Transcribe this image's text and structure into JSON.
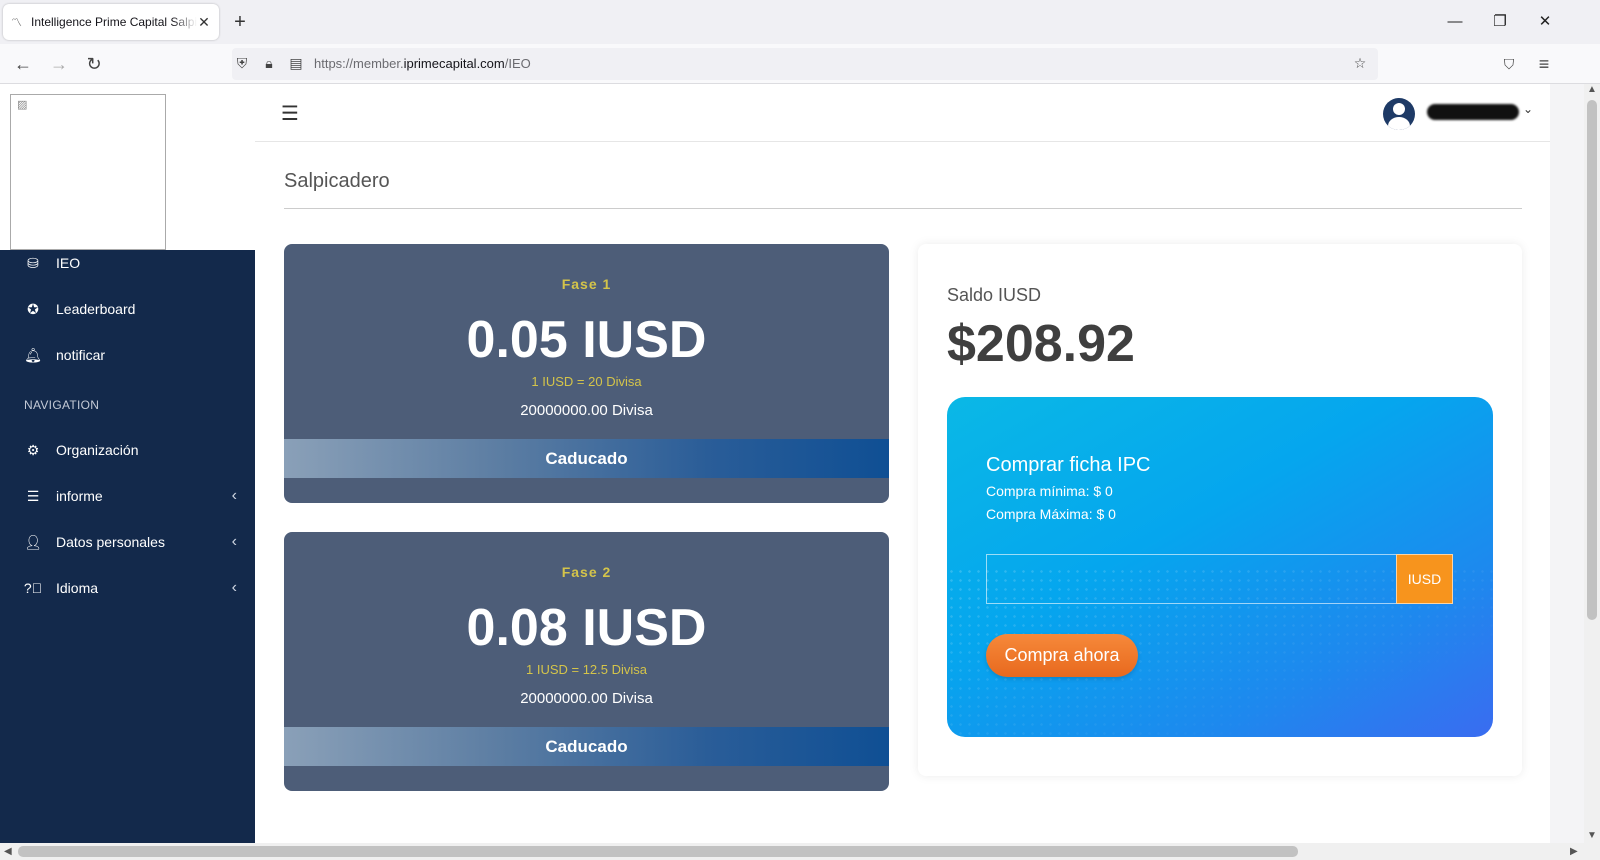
{
  "browser": {
    "tab_title": "Intelligence Prime Capital Salpicadero",
    "tab_close": "✕",
    "new_tab": "+",
    "url_prefix": "https://member.",
    "url_domain": "iprimecapital.com",
    "url_path": "/IEO",
    "icons": {
      "back": "←",
      "forward": "→",
      "reload": "↻",
      "star": "☆",
      "pocket": "⛉",
      "menu": "≡",
      "minimize": "—",
      "restore": "❐",
      "close": "✕"
    }
  },
  "sidebar": {
    "items_top": [
      {
        "label": "IEO",
        "icon": "coins-icon"
      },
      {
        "label": "Leaderboard",
        "icon": "award-icon"
      },
      {
        "label": "notificar",
        "icon": "bell-icon"
      }
    ],
    "nav_heading": "NAVIGATION",
    "items_nav": [
      {
        "label": "Organización",
        "icon": "network-icon"
      },
      {
        "label": "informe",
        "icon": "list-icon"
      },
      {
        "label": "Datos personales",
        "icon": "user-gear-icon"
      },
      {
        "label": "Idioma",
        "icon": "question-circle-icon"
      }
    ]
  },
  "header": {
    "menu_icon": "☰"
  },
  "main": {
    "title": "Salpicadero",
    "phases": [
      {
        "phase": "Fase 1",
        "price": "0.05 IUSD",
        "rate": "1 IUSD = 20 Divisa",
        "supply": "20000000.00 Divisa",
        "status": "Caducado"
      },
      {
        "phase": "Fase 2",
        "price": "0.08 IUSD",
        "rate": "1 IUSD = 12.5 Divisa",
        "supply": "20000000.00 Divisa",
        "status": "Caducado"
      }
    ],
    "balance": {
      "label": "Saldo IUSD",
      "value": "$208.92"
    },
    "buy": {
      "title": "Comprar ficha IPC",
      "min": "Compra mínima: $ 0",
      "max": "Compra Máxima: $ 0",
      "input_value": "",
      "unit": "IUSD",
      "button": "Compra ahora"
    }
  },
  "colors": {
    "sidebar_bg": "#13294b",
    "card_bg": "#4d5d78",
    "accent_yellow": "#d4c44a",
    "buy_button": "#e8691e",
    "unit_badge": "#f7941d"
  }
}
